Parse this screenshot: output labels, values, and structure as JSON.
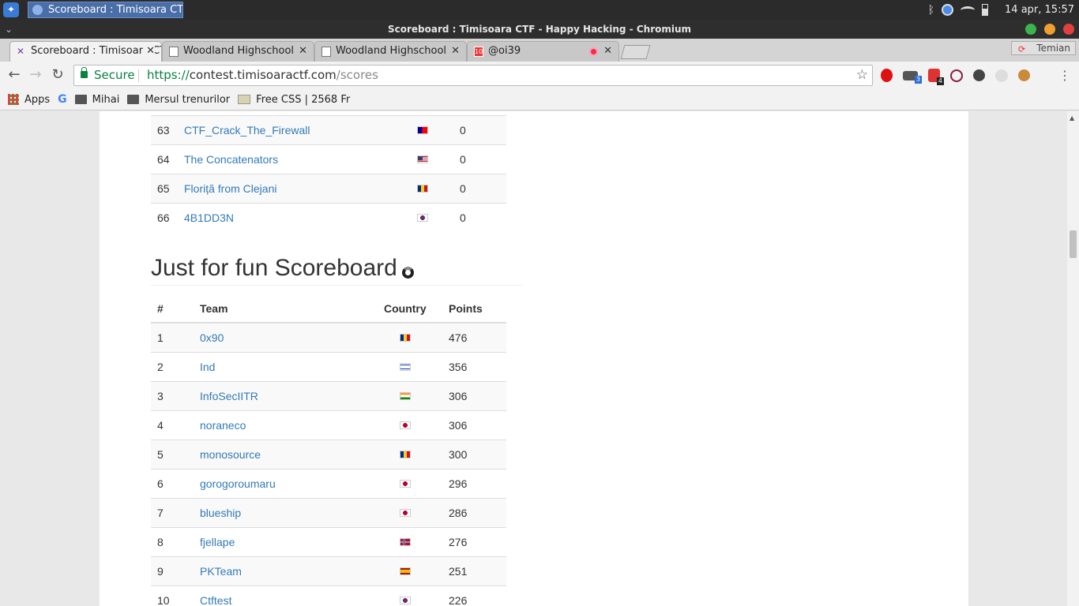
{
  "os": {
    "task_title": "Scoreboard : Timisoara CT...",
    "clock": "14 apr, 15:57"
  },
  "window": {
    "title": "Scoreboard : Timisoara CTF - Happy Hacking - Chromium",
    "menu": "⌄"
  },
  "tabs": [
    {
      "label": "Scoreboard : Timisoara CTF - Happy Hacking",
      "close": "✕"
    },
    {
      "label": "Woodland Highschool",
      "close": "✕"
    },
    {
      "label": "Woodland Highschool",
      "close": "✕"
    },
    {
      "label": "@oi39",
      "close": "✕",
      "favicon_text": "10"
    }
  ],
  "profile": {
    "name": "Temian"
  },
  "toolbar": {
    "back": "←",
    "forward": "→",
    "reload": "↻",
    "secure_label": "Secure",
    "url_scheme": "https://",
    "url_host": "contest.timisoaractf.com",
    "url_path": "/scores",
    "star": "☆",
    "menu": "⋮",
    "ext_badges": [
      "3",
      "4"
    ]
  },
  "bookmarks": [
    {
      "label": "Apps",
      "icon": "apps-icon"
    },
    {
      "label": "",
      "icon": "google-icon",
      "glyph": "G"
    },
    {
      "label": "Mihai",
      "icon": "folder-icon"
    },
    {
      "label": "Mersul trenurilor",
      "icon": "folder-icon"
    },
    {
      "label": "Free CSS | 2568 Fr",
      "icon": "css-icon"
    }
  ],
  "main_scoreboard_tail": [
    {
      "rank": "63",
      "team": "CTF_Crack_The_Firewall",
      "flag": "tw",
      "points": "0"
    },
    {
      "rank": "64",
      "team": "The Concatenators",
      "flag": "us",
      "points": "0"
    },
    {
      "rank": "65",
      "team": "Floriță from Clejani",
      "flag": "ro",
      "points": "0"
    },
    {
      "rank": "66",
      "team": "4B1DD3N",
      "flag": "kr",
      "points": "0"
    }
  ],
  "fun_scoreboard": {
    "title": "Just for fun Scoreboard",
    "headers": {
      "rank": "#",
      "team": "Team",
      "country": "Country",
      "points": "Points"
    },
    "rows": [
      {
        "rank": "1",
        "team": "0x90",
        "flag": "ro",
        "points": "476"
      },
      {
        "rank": "2",
        "team": "Ind",
        "flag": "il",
        "points": "356"
      },
      {
        "rank": "3",
        "team": "InfoSecIITR",
        "flag": "in",
        "points": "306"
      },
      {
        "rank": "4",
        "team": "noraneco",
        "flag": "jp",
        "points": "306"
      },
      {
        "rank": "5",
        "team": "monosource",
        "flag": "ro",
        "points": "300"
      },
      {
        "rank": "6",
        "team": "gorogoroumaru",
        "flag": "jp",
        "points": "296"
      },
      {
        "rank": "7",
        "team": "blueship",
        "flag": "jp",
        "points": "286"
      },
      {
        "rank": "8",
        "team": "fjellape",
        "flag": "no",
        "points": "276"
      },
      {
        "rank": "9",
        "team": "PKTeam",
        "flag": "es",
        "points": "251"
      },
      {
        "rank": "10",
        "team": "Ctftest",
        "flag": "kr",
        "points": "226"
      }
    ]
  }
}
